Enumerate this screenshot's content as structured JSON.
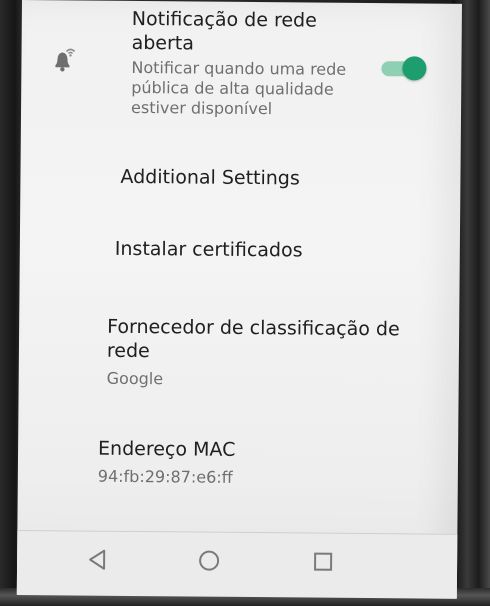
{
  "settings": {
    "open_network_notification": {
      "title_line1": "Notificação de rede",
      "title_line2": "aberta",
      "summary_line1": "Notificar quando uma rede",
      "summary_line2": "pública de alta qualidade",
      "summary_line3": "estiver disponível",
      "icon": "wifi-bell-icon",
      "enabled": true
    },
    "additional_settings": {
      "title": "Additional Settings"
    },
    "install_certificates": {
      "title": "Instalar certificados"
    },
    "network_rating_provider": {
      "title_line1": "Fornecedor de classificação de",
      "title_line2": "rede",
      "summary": "Google"
    },
    "mac_address": {
      "title": "Endereço MAC",
      "value": "94:fb:29:87:e6:ff"
    }
  },
  "navbar": {
    "back_icon": "back-triangle-icon",
    "home_icon": "home-circle-icon",
    "recents_icon": "recents-square-icon"
  },
  "colors": {
    "accent": "#1e9e6e",
    "accent_track": "#8fd0b4",
    "title_text": "#202020",
    "summary_text": "#6f6f6f"
  }
}
